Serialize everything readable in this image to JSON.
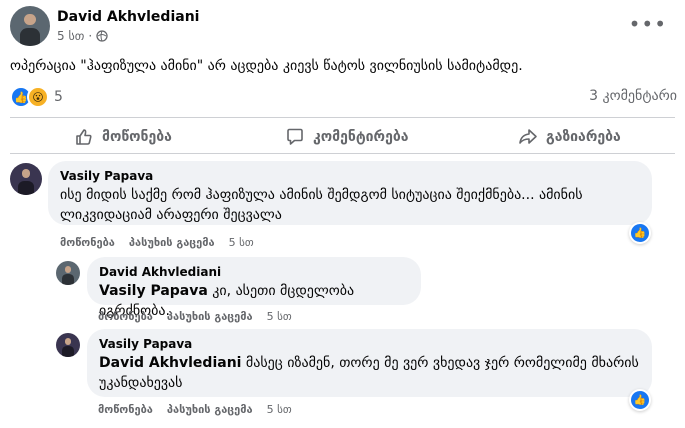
{
  "post": {
    "author": "David Akhvlediani",
    "time": "5 სთ",
    "privacy_sep": "·",
    "text": "ოპერაცია \"ჰაფიზულა ამინი\" არ აცდება კიევს წატოს ვილნიუსის სამიტამდე.",
    "reaction_count": "5",
    "comments_count": "3 კომენტარი"
  },
  "actions": {
    "like": "მოწონება",
    "comment": "კომენტირება",
    "share": "გაზიარება"
  },
  "comments": [
    {
      "name": "Vasily Papava",
      "mention": "",
      "text": "ისე მიდის საქმე რომ ჰაფიზულა ამინის შემდგომ სიტუაცია შეიქმნება... ამინის",
      "text2": "ლიკვიდაციამ არაფერი შეცვალა",
      "like": "მოწონება",
      "reply": "პასუხის გაცემა",
      "time": "5 სთ"
    },
    {
      "name": "David Akhvlediani",
      "mention": "Vasily Papava",
      "text": " კი, ასეთი მცდელობა იგრძნობა.",
      "like": "მოწონება",
      "reply": "პასუხის გაცემა",
      "time": "5 სთ"
    },
    {
      "name": "Vasily Papava",
      "mention": "David Akhvlediani",
      "text": " მასეც იზამენ, თორე მე ვერ ვხედავ ჯერ რომელიმე მხარის",
      "text2": "უკანდახევას",
      "like": "მოწონება",
      "reply": "პასუხის გაცემა",
      "time": "5 სთ"
    }
  ],
  "colors": {
    "accent": "#1877f2",
    "muted": "#65676b",
    "bubble": "#f0f2f5"
  }
}
